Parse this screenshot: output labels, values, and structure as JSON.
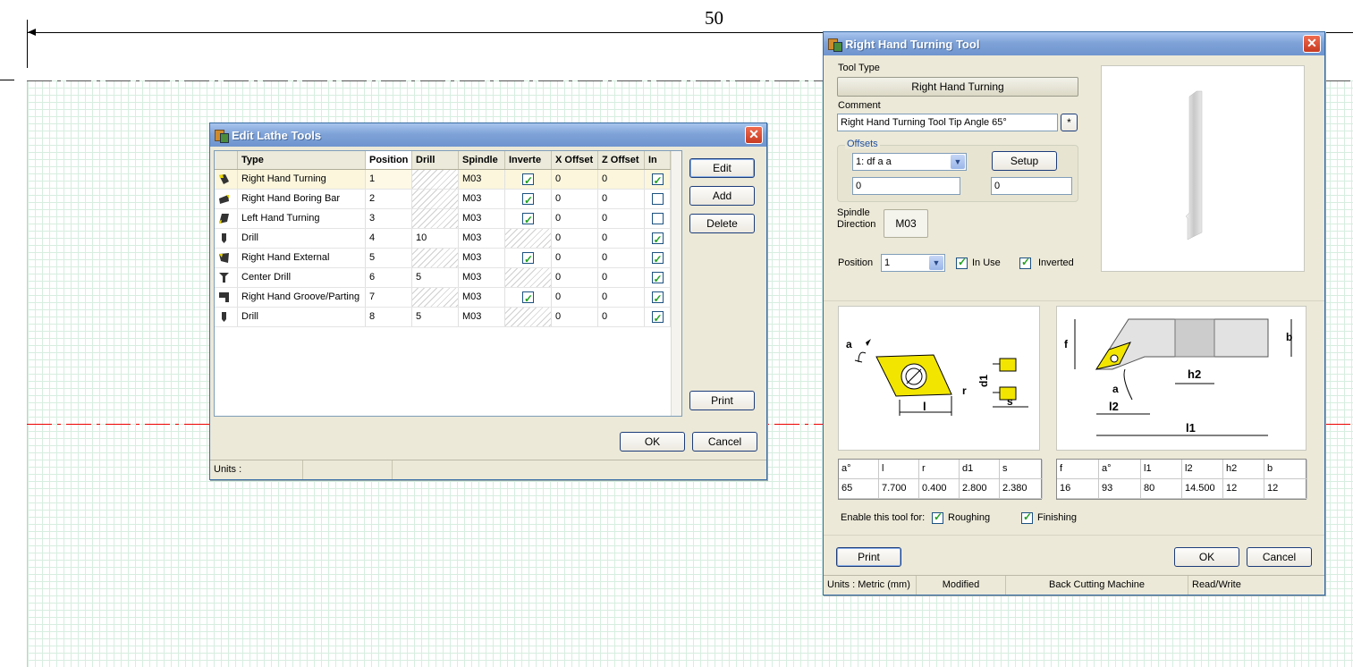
{
  "canvas": {
    "dimension_label": "50"
  },
  "edit_dialog": {
    "title": "Edit Lathe Tools",
    "close_glyph": "✕",
    "columns": [
      "Type",
      "Position",
      "Drill",
      "Spindle",
      "Inverte",
      "X Offset",
      "Z Offset",
      "In"
    ],
    "rows": [
      {
        "type": "Right Hand Turning",
        "position": "1",
        "drill": "",
        "spindle": "M03",
        "inverted": true,
        "x_offset": "0",
        "z_offset": "0",
        "in_use": true
      },
      {
        "type": "Right Hand Boring Bar",
        "position": "2",
        "drill": "",
        "spindle": "M03",
        "inverted": true,
        "x_offset": "0",
        "z_offset": "0",
        "in_use": false
      },
      {
        "type": "Left Hand Turning",
        "position": "3",
        "drill": "",
        "spindle": "M03",
        "inverted": true,
        "x_offset": "0",
        "z_offset": "0",
        "in_use": false
      },
      {
        "type": "Drill",
        "position": "4",
        "drill": "10",
        "spindle": "M03",
        "inverted": null,
        "x_offset": "0",
        "z_offset": "0",
        "in_use": true
      },
      {
        "type": "Right Hand External",
        "position": "5",
        "drill": "",
        "spindle": "M03",
        "inverted": true,
        "x_offset": "0",
        "z_offset": "0",
        "in_use": true
      },
      {
        "type": "Center Drill",
        "position": "6",
        "drill": "5",
        "spindle": "M03",
        "inverted": null,
        "x_offset": "0",
        "z_offset": "0",
        "in_use": true
      },
      {
        "type": "Right Hand Groove/Parting",
        "position": "7",
        "drill": "",
        "spindle": "M03",
        "inverted": true,
        "x_offset": "0",
        "z_offset": "0",
        "in_use": true
      },
      {
        "type": "Drill",
        "position": "8",
        "drill": "5",
        "spindle": "M03",
        "inverted": null,
        "x_offset": "0",
        "z_offset": "0",
        "in_use": true
      }
    ],
    "buttons": {
      "edit": "Edit",
      "add": "Add",
      "delete": "Delete",
      "print": "Print",
      "ok": "OK",
      "cancel": "Cancel"
    },
    "status": {
      "units": "Units :"
    }
  },
  "tool_dialog": {
    "title": "Right Hand Turning Tool",
    "close_glyph": "✕",
    "tool_type_label": "Tool Type",
    "tool_type_value": "Right Hand Turning",
    "comment_label": "Comment",
    "comment_value": "Right Hand Turning Tool Tip Angle 65°",
    "comment_button": "*",
    "offsets_label": "Offsets",
    "offset_select": "1: df a a",
    "setup_button": "Setup",
    "offset_x": "0",
    "offset_z": "0",
    "spindle_label_1": "Spindle",
    "spindle_label_2": "Direction",
    "spindle_value": "M03",
    "position_label": "Position",
    "position_value": "1",
    "in_use_label": "In Use",
    "in_use": true,
    "inverted_label": "Inverted",
    "inverted": true,
    "insert_diagram": {
      "a": "a",
      "l": "l",
      "r": "r",
      "d1": "d1",
      "s": "s"
    },
    "holder_diagram": {
      "f": "f",
      "b": "b",
      "h2": "h2",
      "a": "a",
      "l2": "l2",
      "l1": "l1"
    },
    "insert_table": {
      "headers": [
        "a°",
        "l",
        "r",
        "d1",
        "s"
      ],
      "values": [
        "65",
        "7.700",
        "0.400",
        "2.800",
        "2.380"
      ]
    },
    "holder_table": {
      "headers": [
        "f",
        "a°",
        "l1",
        "l2",
        "h2",
        "b"
      ],
      "values": [
        "16",
        "93",
        "80",
        "14.500",
        "12",
        "12"
      ]
    },
    "enable_label": "Enable this tool for:",
    "roughing_label": "Roughing",
    "roughing": true,
    "finishing_label": "Finishing",
    "finishing": true,
    "buttons": {
      "print": "Print",
      "ok": "OK",
      "cancel": "Cancel"
    },
    "status": [
      "Units : Metric (mm)",
      "Modified",
      "Back Cutting Machine",
      "Read/Write"
    ]
  },
  "colors": {
    "accent": "#3a6ea5",
    "insert_yellow": "#f2e600",
    "check_green": "#21a121"
  }
}
